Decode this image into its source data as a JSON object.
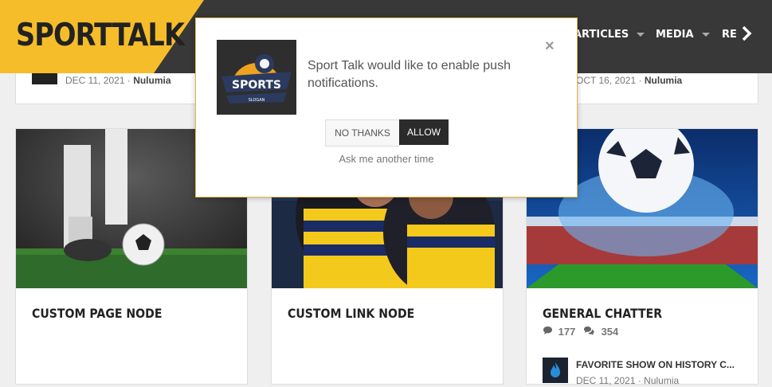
{
  "header": {
    "logo": "SPORTTALK",
    "nav": [
      {
        "label": "ARTICLES"
      },
      {
        "label": "MEDIA"
      },
      {
        "label": "RE"
      }
    ],
    "next_icon": "chevron-right-icon"
  },
  "top_cards": [
    {
      "date": "DEC 11, 2021",
      "separator": "·",
      "author": "Nulumia"
    },
    {
      "date": "OCT 16, 2021",
      "separator": "·",
      "author": "Nulumia"
    }
  ],
  "cards": [
    {
      "title": "CUSTOM PAGE NODE"
    },
    {
      "title": "CUSTOM LINK NODE"
    },
    {
      "title": "GENERAL CHATTER",
      "stats": {
        "comments": "177",
        "messages": "354"
      },
      "sub_item": {
        "title": "FAVORITE SHOW ON HISTORY C...",
        "meta": "DEC 11, 2021 · Nulumia"
      }
    }
  ],
  "popup": {
    "logo_text": "SPORTS",
    "logo_sub": "SLOGAN",
    "message": "Sport Talk would like to enable push notifications.",
    "close_label": "×",
    "no_thanks": "NO THANKS",
    "allow": "ALLOW",
    "later": "Ask me another time"
  },
  "colors": {
    "accent": "#f6bd2a",
    "header_bg": "#383838",
    "card_bg": "#ffffff"
  }
}
